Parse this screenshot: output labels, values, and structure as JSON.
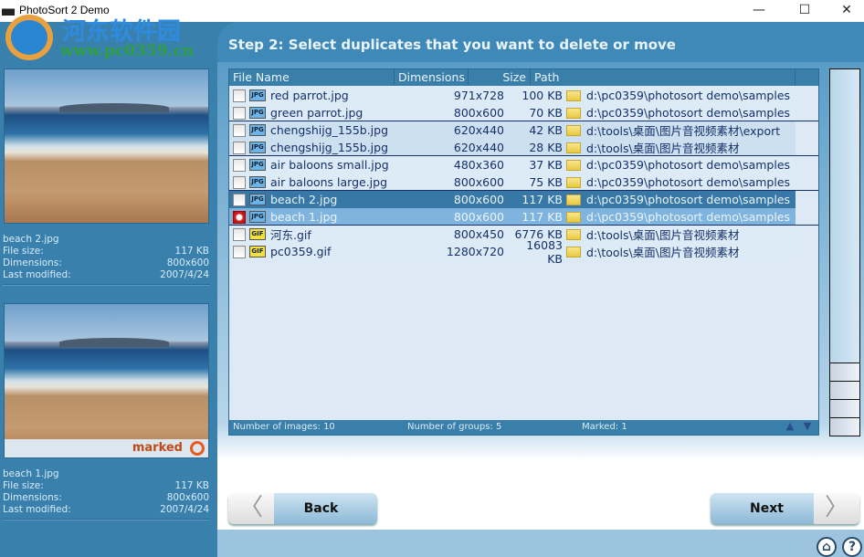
{
  "window": {
    "title": "PhotoSort 2 Demo",
    "minimize": "—",
    "maximize": "☐",
    "close": "✕"
  },
  "watermark": {
    "line1": "河东软件园",
    "line2": "www.pc0359.cn"
  },
  "preview": [
    {
      "name": "beach 2.jpg",
      "file_size_label": "File size:",
      "file_size": "117 KB",
      "dimensions_label": "Dimensions:",
      "dimensions": "800x600",
      "modified_label": "Last modified:",
      "modified": "2007/4/24",
      "marked": false
    },
    {
      "name": "beach 1.jpg",
      "file_size_label": "File size:",
      "file_size": "117 KB",
      "dimensions_label": "Dimensions:",
      "dimensions": "800x600",
      "modified_label": "Last modified:",
      "modified": "2007/4/24",
      "marked": true,
      "marked_label": "marked"
    }
  ],
  "step_title": "Step 2:  Select duplicates that you want to delete or move",
  "table": {
    "columns": [
      "File Name",
      "Dimensions",
      "Size",
      "Path"
    ],
    "rows": [
      {
        "name": "red parrot.jpg",
        "type": "JPG",
        "dim": "971x728",
        "size": "100 KB",
        "path": "d:\\pc0359\\photosort demo\\samples",
        "group": 0,
        "checked": false,
        "state": ""
      },
      {
        "name": "green parrot.jpg",
        "type": "JPG",
        "dim": "800x600",
        "size": "70 KB",
        "path": "d:\\pc0359\\photosort demo\\samples",
        "group": 0,
        "checked": false,
        "state": ""
      },
      {
        "name": "chengshijg_155b.jpg",
        "type": "JPG",
        "dim": "620x440",
        "size": "42 KB",
        "path": "d:\\tools\\桌面\\图片音视频素材\\export",
        "group": 1,
        "checked": false,
        "state": ""
      },
      {
        "name": "chengshijg_155b.jpg",
        "type": "JPG",
        "dim": "620x440",
        "size": "28 KB",
        "path": "d:\\tools\\桌面\\图片音视频素材",
        "group": 1,
        "checked": false,
        "state": ""
      },
      {
        "name": "air baloons small.jpg",
        "type": "JPG",
        "dim": "480x360",
        "size": "37 KB",
        "path": "d:\\pc0359\\photosort demo\\samples",
        "group": 0,
        "checked": false,
        "state": ""
      },
      {
        "name": "air baloons large.jpg",
        "type": "JPG",
        "dim": "800x600",
        "size": "75 KB",
        "path": "d:\\pc0359\\photosort demo\\samples",
        "group": 0,
        "checked": false,
        "state": ""
      },
      {
        "name": "beach 2.jpg",
        "type": "JPG",
        "dim": "800x600",
        "size": "117 KB",
        "path": "d:\\pc0359\\photosort demo\\samples",
        "group": 1,
        "checked": false,
        "state": "selected"
      },
      {
        "name": "beach 1.jpg",
        "type": "JPG",
        "dim": "800x600",
        "size": "117 KB",
        "path": "d:\\pc0359\\photosort demo\\samples",
        "group": 1,
        "checked": true,
        "state": "marked"
      },
      {
        "name": "河东.gif",
        "type": "GIF",
        "dim": "800x450",
        "size": "6776 KB",
        "path": "d:\\tools\\桌面\\图片音视频素材",
        "group": 0,
        "checked": false,
        "state": ""
      },
      {
        "name": "pc0359.gif",
        "type": "GIF",
        "dim": "1280x720",
        "size": "16083 KB",
        "path": "d:\\tools\\桌面\\图片音视频素材",
        "group": 0,
        "checked": false,
        "state": ""
      }
    ],
    "status": {
      "images": "Number of images: 10",
      "groups": "Number of groups: 5",
      "marked": "Marked: 1"
    }
  },
  "buttons": {
    "back": "Back",
    "next": "Next"
  },
  "footer_icons": [
    "basket-icon",
    "help-icon"
  ]
}
